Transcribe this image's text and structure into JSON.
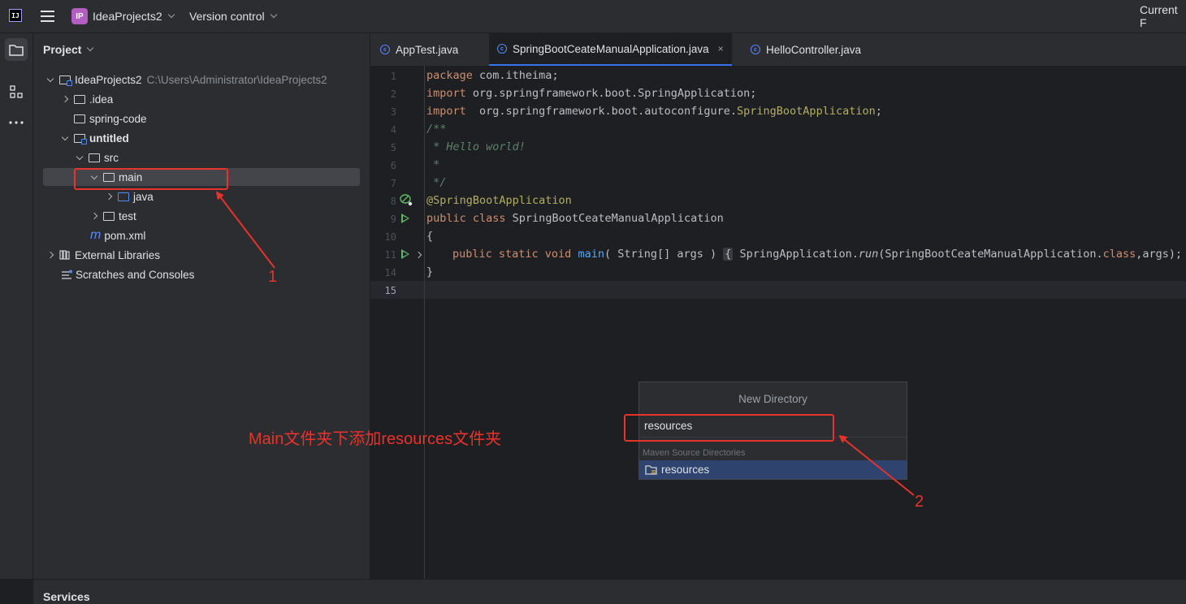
{
  "titlebar": {
    "logo_text": "IJ",
    "project_badge": "IP",
    "project_name": "IdeaProjects2",
    "vcs_label": "Version control",
    "right_label": "Current F"
  },
  "project_panel": {
    "title": "Project",
    "tree": [
      {
        "label": "IdeaProjects2",
        "path": "C:\\Users\\Administrator\\IdeaProjects2"
      },
      {
        "label": ".idea"
      },
      {
        "label": "spring-code"
      },
      {
        "label": "untitled"
      },
      {
        "label": "src"
      },
      {
        "label": "main"
      },
      {
        "label": "java"
      },
      {
        "label": "test"
      },
      {
        "label": "pom.xml",
        "icon": "m"
      },
      {
        "label": "External Libraries"
      },
      {
        "label": "Scratches and Consoles"
      }
    ]
  },
  "editor": {
    "tabs": [
      {
        "label": "AppTest.java"
      },
      {
        "label": "SpringBootCeateManualApplication.java"
      },
      {
        "label": "HelloController.java"
      }
    ],
    "close_glyph": "×",
    "line_numbers": [
      "1",
      "2",
      "3",
      "4",
      "5",
      "6",
      "7",
      "8",
      "9",
      "10",
      "11",
      "14",
      "15"
    ],
    "code": {
      "l1_kw": "package",
      "l1_rest": " com.itheima;",
      "l2_kw": "import",
      "l2_rest": " org.springframework.boot.SpringApplication;",
      "l3_kw": "import",
      "l3_rest": "  org.springframework.boot.autoconfigure.",
      "l3_ann": "SpringBootApplication",
      "l3_end": ";",
      "l4": "/**",
      "l5": " * Hello world!",
      "l6": " *",
      "l7": " */",
      "l8": "@SpringBootApplication",
      "l9_kw": "public class",
      "l9_rest": " SpringBootCeateManualApplication",
      "l10": "{",
      "l11_kw": "public static void",
      "l11_fn": "main",
      "l11_a": "( String[] args ) ",
      "l11_ob": "{",
      "l11_b": " SpringApplication.",
      "l11_run": "run",
      "l11_c": "(SpringBootCeateManualApplication.",
      "l11_cls": "class",
      "l11_d": ",args); ",
      "l11_cb": "}",
      "l14": "}"
    }
  },
  "popup": {
    "title": "New Directory",
    "input_value": "resources",
    "section": "Maven Source Directories",
    "item": "resources"
  },
  "services": {
    "label": "Services"
  },
  "annotations": {
    "label1": "1",
    "label2": "2",
    "note": "Main文件夹下添加resources文件夹",
    "color": "#e8322c"
  }
}
